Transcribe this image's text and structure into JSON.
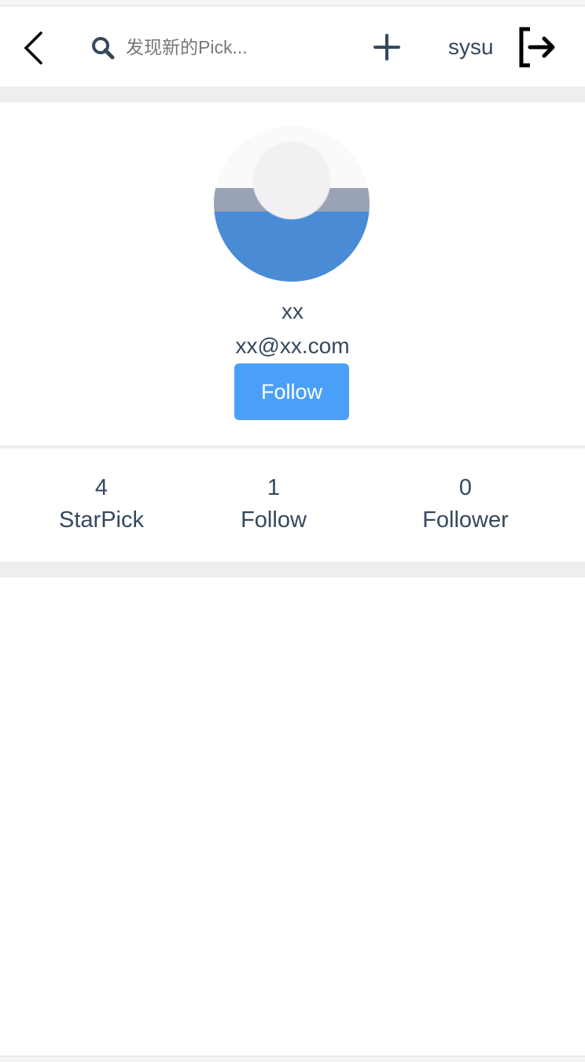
{
  "header": {
    "search_placeholder": "发现新的Pick...",
    "username": "sysu"
  },
  "profile": {
    "name": "xx",
    "email": "xx@xx.com",
    "follow_label": "Follow"
  },
  "stats": [
    {
      "value": "4",
      "label": "StarPick"
    },
    {
      "value": "1",
      "label": "Follow"
    },
    {
      "value": "0",
      "label": "Follower"
    }
  ],
  "colors": {
    "accent": "#4aa0f8",
    "text": "#34495e",
    "band": "#eeeeee"
  }
}
